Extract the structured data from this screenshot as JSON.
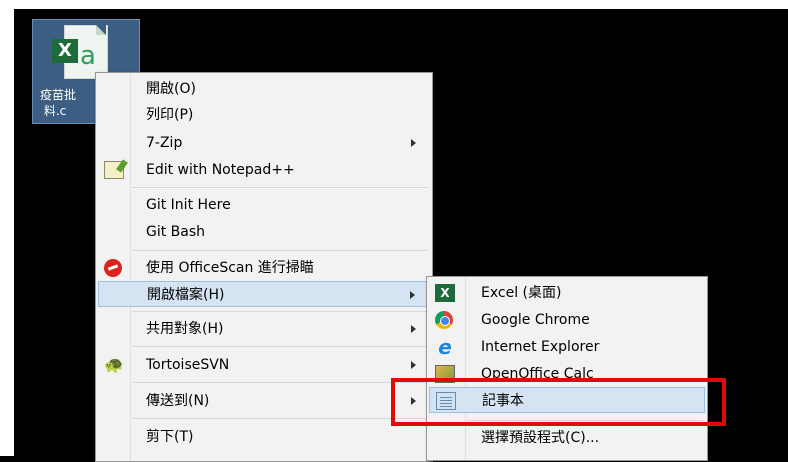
{
  "desktop": {
    "file": {
      "label_line1": "疫苗批",
      "label_line2": "料.c"
    }
  },
  "context_menu": {
    "items": [
      {
        "label": "開啟(O)"
      },
      {
        "label": "列印(P)"
      },
      {
        "label": "7-Zip",
        "submenu": true
      },
      {
        "label": "Edit with Notepad++",
        "icon": "notepadpp-icon"
      },
      {
        "label": "Git Init Here"
      },
      {
        "label": "Git Bash"
      },
      {
        "label": "使用 OfficeScan 進行掃瞄",
        "icon": "officescan-icon"
      },
      {
        "label": "開啟檔案(H)",
        "submenu": true,
        "highlighted": true
      },
      {
        "label": "共用對象(H)",
        "submenu": true
      },
      {
        "label": "TortoiseSVN",
        "icon": "tortoisesvn-icon",
        "submenu": true
      },
      {
        "label": "傳送到(N)",
        "submenu": true
      },
      {
        "label": "剪下(T)"
      }
    ]
  },
  "open_with_submenu": {
    "items": [
      {
        "label": "Excel (桌面)",
        "icon": "excel-icon"
      },
      {
        "label": "Google Chrome",
        "icon": "chrome-icon"
      },
      {
        "label": "Internet Explorer",
        "icon": "ie-icon"
      },
      {
        "label": "OpenOffice Calc",
        "icon": "openoffice-calc-icon"
      },
      {
        "label": "記事本",
        "icon": "notepad-icon",
        "highlighted": true
      },
      {
        "label": "選擇預設程式(C)..."
      }
    ]
  },
  "annotation": {
    "color": "#e00a0a"
  }
}
